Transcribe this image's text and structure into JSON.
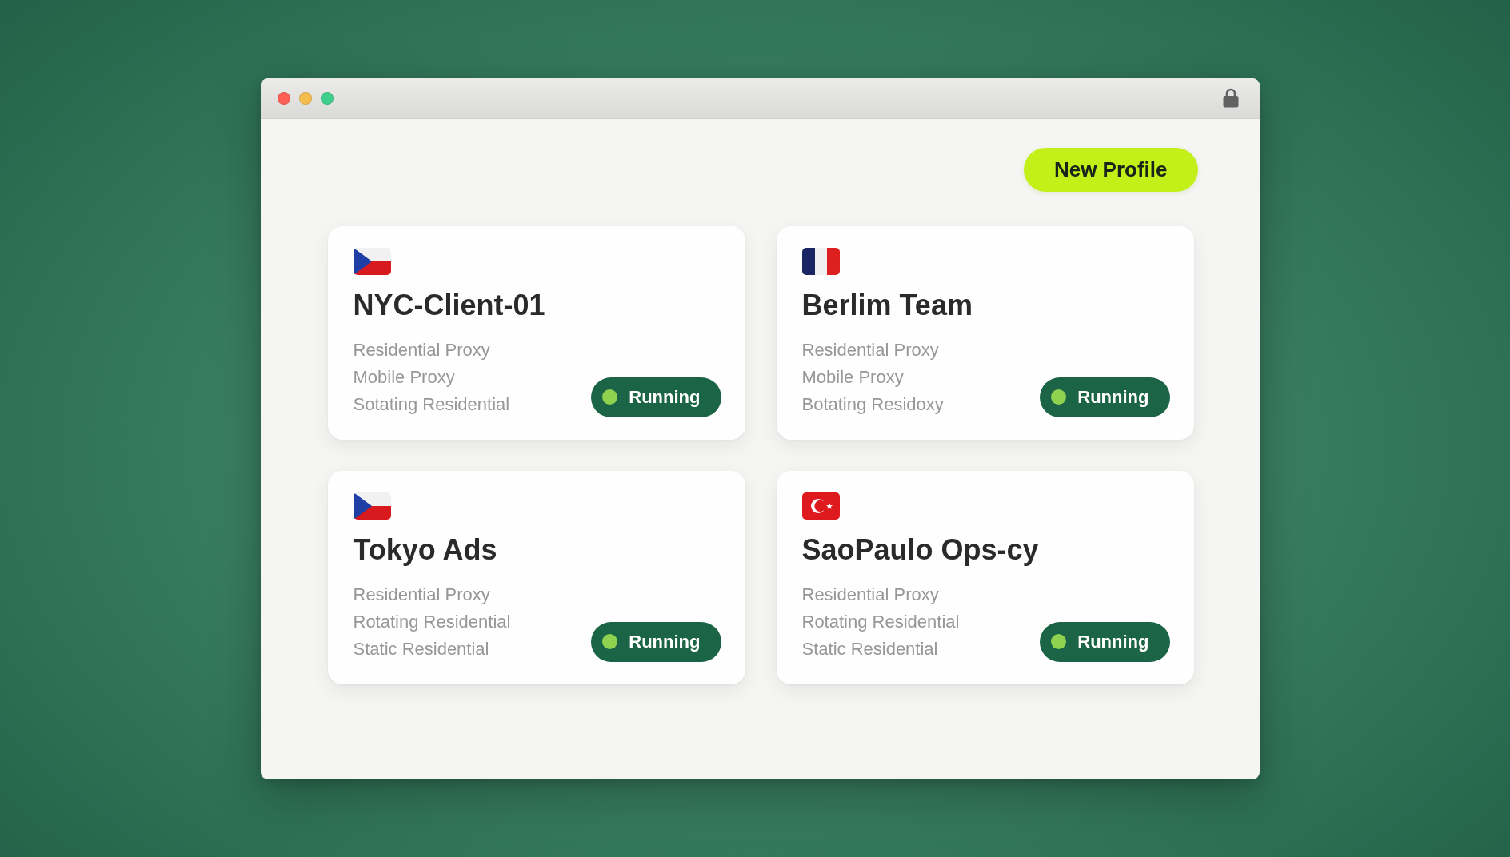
{
  "toolbar": {
    "new_profile_button": "New Profile"
  },
  "profiles": [
    {
      "kind": "cz",
      "name": "NYC-Client-01",
      "proxies": [
        "Residential Proxy",
        "Mobile Proxy",
        "Sotating Residential"
      ],
      "status": "Running"
    },
    {
      "kind": "fr",
      "name": "Berlim Team",
      "proxies": [
        "Residential Proxy",
        "Mobile Proxy",
        "Botating Residoxy"
      ],
      "status": "Running"
    },
    {
      "kind": "cz",
      "name": "Tokyo Ads",
      "proxies": [
        "Residential Proxy",
        "Rotating Residential",
        "Static Residential"
      ],
      "status": "Running"
    },
    {
      "kind": "tr",
      "name": "SaoPaulo Ops-cy",
      "proxies": [
        "Residential Proxy",
        "Rotating Residential",
        "Static Residential"
      ],
      "status": "Running"
    }
  ]
}
